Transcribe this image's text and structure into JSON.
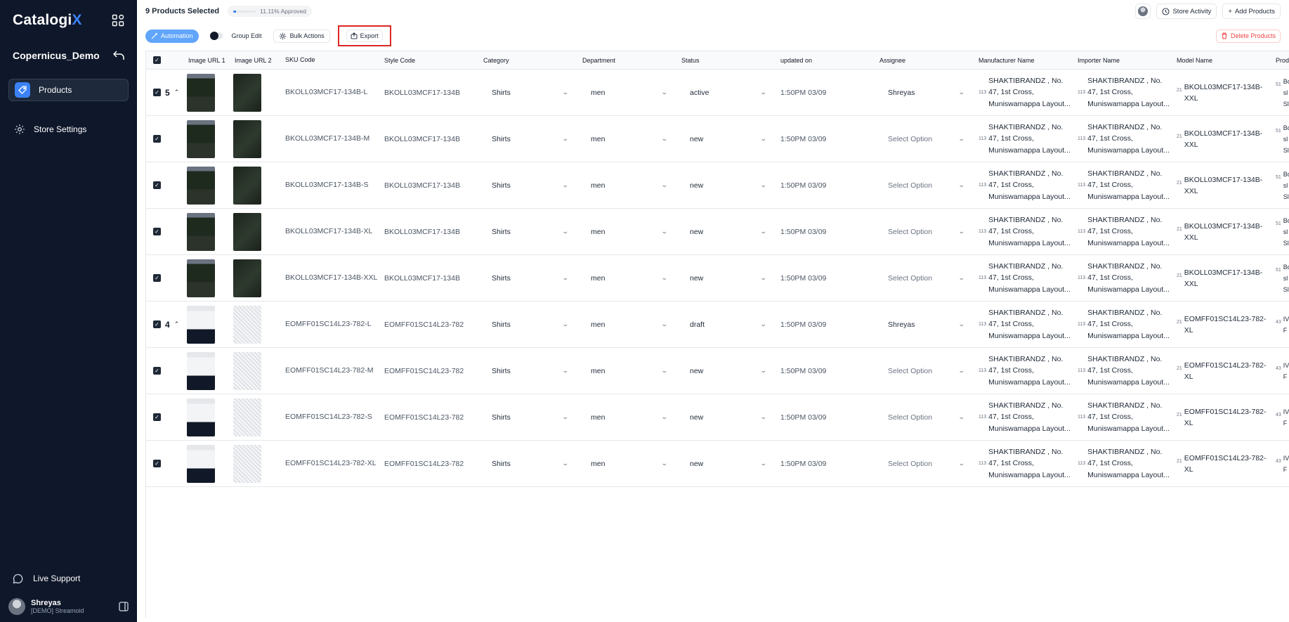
{
  "sidebar": {
    "logo_main": "Catalogi",
    "logo_x": "X",
    "store_name": "Copernicus_Demo",
    "nav": [
      {
        "label": "Products",
        "icon": "tag-icon"
      },
      {
        "label": "Store Settings",
        "icon": "gear-icon"
      }
    ],
    "support_label": "Live Support",
    "user_name": "Shreyas",
    "user_org": "[DEMO] Streamoid"
  },
  "topbar": {
    "selected_text": "9 Products Selected",
    "approved_text": "11.11% Approved",
    "approved_fraction": 0.1111,
    "store_activity": "Store Activity",
    "add_products": "Add Products"
  },
  "toolbar": {
    "automation": "Automation",
    "group_edit": "Group Edit",
    "bulk_actions": "Bulk Actions",
    "export": "Export",
    "delete_products": "Delete Products"
  },
  "columns": [
    "Image URL 1",
    "Image URL 2",
    "SKU Code",
    "Style Code",
    "Category",
    "Department",
    "Status",
    "updated on",
    "Assignee",
    "Manufacturer Name",
    "Importer Name",
    "Model Name",
    "Prod"
  ],
  "rows": [
    {
      "group": "5",
      "img": "dark",
      "sku": "BKOLL03MCF17-134B-L",
      "style": "BKOLL03MCF17-134B",
      "category": "Shirts",
      "department": "men",
      "status": "active",
      "updated": "1:50PM 03/09",
      "assignee": "Shreyas",
      "assignee_set": true,
      "mfr_n": "113",
      "mfr": "SHAKTIBRANDZ , No. 47, 1st Cross, Muniswamappa Layout...",
      "imp_n": "113",
      "imp": "SHAKTIBRANDZ , No. 47, 1st Cross, Muniswamappa Layout...",
      "model_n": "21",
      "model": "BKOLL03MCF17-134B-XXL",
      "prod_n": "51",
      "prod": "Bo sl Sl"
    },
    {
      "group": "",
      "img": "dark",
      "sku": "BKOLL03MCF17-134B-M",
      "style": "BKOLL03MCF17-134B",
      "category": "Shirts",
      "department": "men",
      "status": "new",
      "updated": "1:50PM 03/09",
      "assignee": "Select Option",
      "assignee_set": false,
      "mfr_n": "113",
      "mfr": "SHAKTIBRANDZ , No. 47, 1st Cross, Muniswamappa Layout...",
      "imp_n": "113",
      "imp": "SHAKTIBRANDZ , No. 47, 1st Cross, Muniswamappa Layout...",
      "model_n": "21",
      "model": "BKOLL03MCF17-134B-XXL",
      "prod_n": "51",
      "prod": "Bo sl Sl"
    },
    {
      "group": "",
      "img": "dark",
      "sku": "BKOLL03MCF17-134B-S",
      "style": "BKOLL03MCF17-134B",
      "category": "Shirts",
      "department": "men",
      "status": "new",
      "updated": "1:50PM 03/09",
      "assignee": "Select Option",
      "assignee_set": false,
      "mfr_n": "113",
      "mfr": "SHAKTIBRANDZ , No. 47, 1st Cross, Muniswamappa Layout...",
      "imp_n": "113",
      "imp": "SHAKTIBRANDZ , No. 47, 1st Cross, Muniswamappa Layout...",
      "model_n": "21",
      "model": "BKOLL03MCF17-134B-XXL",
      "prod_n": "51",
      "prod": "Bo sl Sl"
    },
    {
      "group": "",
      "img": "dark",
      "sku": "BKOLL03MCF17-134B-XL",
      "style": "BKOLL03MCF17-134B",
      "category": "Shirts",
      "department": "men",
      "status": "new",
      "updated": "1:50PM 03/09",
      "assignee": "Select Option",
      "assignee_set": false,
      "mfr_n": "113",
      "mfr": "SHAKTIBRANDZ , No. 47, 1st Cross, Muniswamappa Layout...",
      "imp_n": "113",
      "imp": "SHAKTIBRANDZ , No. 47, 1st Cross, Muniswamappa Layout...",
      "model_n": "21",
      "model": "BKOLL03MCF17-134B-XXL",
      "prod_n": "51",
      "prod": "Bo sl Sl"
    },
    {
      "group": "",
      "img": "dark",
      "sku": "BKOLL03MCF17-134B-XXL",
      "style": "BKOLL03MCF17-134B",
      "category": "Shirts",
      "department": "men",
      "status": "new",
      "updated": "1:50PM 03/09",
      "assignee": "Select Option",
      "assignee_set": false,
      "mfr_n": "113",
      "mfr": "SHAKTIBRANDZ , No. 47, 1st Cross, Muniswamappa Layout...",
      "imp_n": "113",
      "imp": "SHAKTIBRANDZ , No. 47, 1st Cross, Muniswamappa Layout...",
      "model_n": "21",
      "model": "BKOLL03MCF17-134B-XXL",
      "prod_n": "51",
      "prod": "Bo sl Sl"
    },
    {
      "group": "4",
      "img": "white",
      "sku": "EOMFF01SC14L23-782-L",
      "style": "EOMFF01SC14L23-782",
      "category": "Shirts",
      "department": "men",
      "status": "draft",
      "updated": "1:50PM 03/09",
      "assignee": "Shreyas",
      "assignee_set": true,
      "mfr_n": "113",
      "mfr": "SHAKTIBRANDZ , No. 47, 1st Cross, Muniswamappa Layout...",
      "imp_n": "113",
      "imp": "SHAKTIBRANDZ , No. 47, 1st Cross, Muniswamappa Layout...",
      "model_n": "21",
      "model": "EOMFF01SC14L23-782-XL",
      "prod_n": "43",
      "prod": "IV F"
    },
    {
      "group": "",
      "img": "white",
      "sku": "EOMFF01SC14L23-782-M",
      "style": "EOMFF01SC14L23-782",
      "category": "Shirts",
      "department": "men",
      "status": "new",
      "updated": "1:50PM 03/09",
      "assignee": "Select Option",
      "assignee_set": false,
      "mfr_n": "113",
      "mfr": "SHAKTIBRANDZ , No. 47, 1st Cross, Muniswamappa Layout...",
      "imp_n": "113",
      "imp": "SHAKTIBRANDZ , No. 47, 1st Cross, Muniswamappa Layout...",
      "model_n": "21",
      "model": "EOMFF01SC14L23-782-XL",
      "prod_n": "43",
      "prod": "IV F"
    },
    {
      "group": "",
      "img": "white",
      "sku": "EOMFF01SC14L23-782-S",
      "style": "EOMFF01SC14L23-782",
      "category": "Shirts",
      "department": "men",
      "status": "new",
      "updated": "1:50PM 03/09",
      "assignee": "Select Option",
      "assignee_set": false,
      "mfr_n": "113",
      "mfr": "SHAKTIBRANDZ , No. 47, 1st Cross, Muniswamappa Layout...",
      "imp_n": "113",
      "imp": "SHAKTIBRANDZ , No. 47, 1st Cross, Muniswamappa Layout...",
      "model_n": "21",
      "model": "EOMFF01SC14L23-782-XL",
      "prod_n": "43",
      "prod": "IV F"
    },
    {
      "group": "",
      "img": "white",
      "sku": "EOMFF01SC14L23-782-XL",
      "style": "EOMFF01SC14L23-782",
      "category": "Shirts",
      "department": "men",
      "status": "new",
      "updated": "1:50PM 03/09",
      "assignee": "Select Option",
      "assignee_set": false,
      "mfr_n": "113",
      "mfr": "SHAKTIBRANDZ , No. 47, 1st Cross, Muniswamappa Layout...",
      "imp_n": "113",
      "imp": "SHAKTIBRANDZ , No. 47, 1st Cross, Muniswamappa Layout...",
      "model_n": "21",
      "model": "EOMFF01SC14L23-782-XL",
      "prod_n": "43",
      "prod": "IV F"
    }
  ],
  "colors": {
    "sidebar_bg": "#0f172a",
    "accent": "#3b82f6",
    "automation": "#60a5fa",
    "delete": "#ef4444",
    "export_highlight": "#dc2626"
  }
}
